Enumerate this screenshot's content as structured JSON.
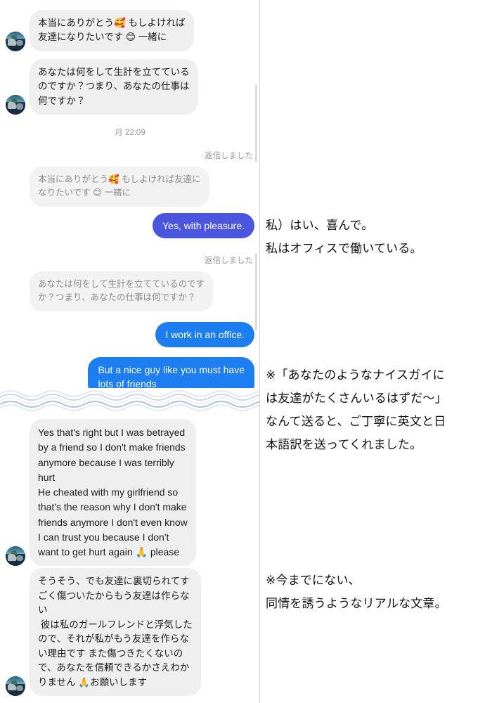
{
  "colors": {
    "bubble_gray": "#efefef",
    "bubble_quote": "#f2f2f2",
    "bubble_blue_indigo": "#4a55e0",
    "bubble_blue_bright": "#1c7ef0",
    "text_muted": "#9a9a9a",
    "wave_blue": "#aec4e0",
    "page_bg": "#ffffff"
  },
  "chat": {
    "messages": [
      {
        "id": "m1",
        "side": "in",
        "kind": "gray",
        "avatar": true,
        "text": "本当にありがとう🥰 もしよければ\n友達になりたいです 😊 一緒に"
      },
      {
        "id": "m2",
        "side": "in",
        "kind": "gray",
        "avatar": true,
        "text": "あなたは何をして生計を立てている\nのですか？つまり、あなたの仕事は\n何ですか？"
      }
    ],
    "timestamp": "月 22:09",
    "reply_label_1": "返信しました",
    "quote_1": "本当にありがとう🥰 もしよければ友達に\nなりたいです 😊 一緒に",
    "sent_1": "Yes, with pleasure.",
    "reply_label_2": "返信しました",
    "quote_2": "あなたは何をして生計を立てているのです\nか？つまり、あなたの仕事は何ですか？",
    "sent_2": "I work in an office.",
    "sent_3": "But a nice guy like you must have\nlots of friends",
    "received_en": "Yes that's right but I was betrayed\nby a friend so I don't make friends\nanymore because I was terribly\nhurt\nHe cheated with my girlfriend so\nthat's the reason why I don't make\nfriends anymore I don't even know\nI can trust you because I don't\nwant to get hurt again 🙏 please",
    "received_ja": "そうそう、でも友達に裏切られてす\nごく傷ついたからもう友達は作らな\nい\n 彼は私のガールフレンドと浮気した\nので、それが私がもう友達を作らな\nい理由です また傷つきたくないの\nで、あなたを信頼できるかさえわか\nりません 🙏お願いします"
  },
  "notes": [
    {
      "id": "note1",
      "lines": [
        "私）はい、喜んで。",
        "私はオフィスで働いている。"
      ]
    },
    {
      "id": "note2",
      "lines": [
        "※「あなたのようなナイスガイに",
        "は友達がたくさんいるはずだ〜」",
        "なんて送ると、ご丁寧に英文と日",
        "本語訳を送ってくれました。"
      ]
    },
    {
      "id": "note3",
      "lines": [
        "※今までにない、",
        "同情を誘うようなリアルな文章。"
      ]
    }
  ]
}
